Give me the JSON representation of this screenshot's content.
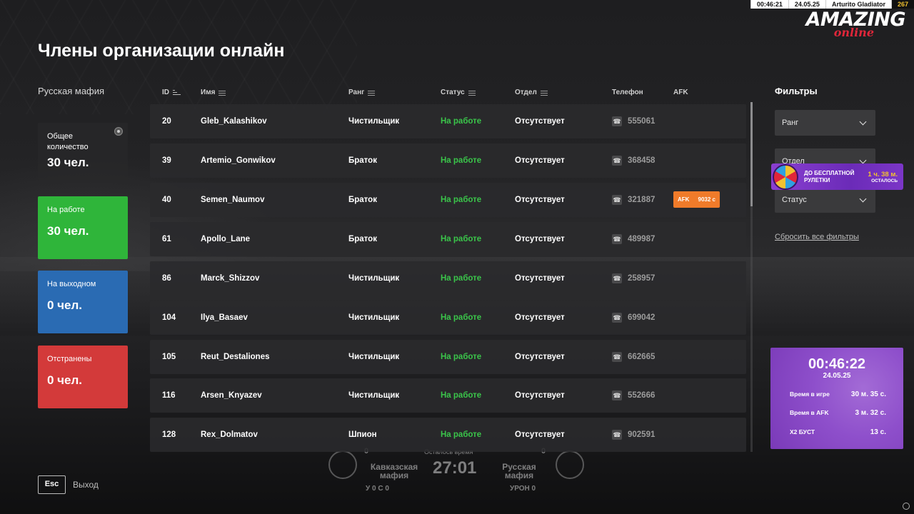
{
  "hud": {
    "time": "00:46:21",
    "date": "24.05.25",
    "player": "Arturito Gladiator",
    "level": "267"
  },
  "logo": {
    "main": "AMAZING",
    "sub": "online"
  },
  "page_title": "Члены организации онлайн",
  "org_name": "Русская мафия",
  "stats": {
    "total": {
      "label": "Общее количество",
      "value": "30 чел."
    },
    "working": {
      "label": "На работе",
      "value": "30 чел.",
      "color": "#2fb53a"
    },
    "off": {
      "label": "На выходном",
      "value": "0 чел.",
      "color": "#2a6bb3"
    },
    "suspended": {
      "label": "Отстранены",
      "value": "0 чел.",
      "color": "#d33a3a"
    }
  },
  "table": {
    "columns": {
      "id": "ID",
      "name": "Имя",
      "rank": "Ранг",
      "status": "Статус",
      "dept": "Отдел",
      "phone": "Телефон",
      "afk": "AFK"
    },
    "rows": [
      {
        "id": "20",
        "name": "Gleb_Kalashikov",
        "rank": "Чистильщик",
        "status": "На работе",
        "dept": "Отсутствует",
        "phone": "555061"
      },
      {
        "id": "39",
        "name": "Artemio_Gonwikov",
        "rank": "Браток",
        "status": "На работе",
        "dept": "Отсутствует",
        "phone": "368458"
      },
      {
        "id": "40",
        "name": "Semen_Naumov",
        "rank": "Браток",
        "status": "На работе",
        "dept": "Отсутствует",
        "phone": "321887",
        "afk_label": "AFK",
        "afk_value": "9032 с"
      },
      {
        "id": "61",
        "name": "Apollo_Lane",
        "rank": "Браток",
        "status": "На работе",
        "dept": "Отсутствует",
        "phone": "489987"
      },
      {
        "id": "86",
        "name": "Marck_Shizzov",
        "rank": "Чистильщик",
        "status": "На работе",
        "dept": "Отсутствует",
        "phone": "258957"
      },
      {
        "id": "104",
        "name": "Ilya_Basaev",
        "rank": "Чистильщик",
        "status": "На работе",
        "dept": "Отсутствует",
        "phone": "699042"
      },
      {
        "id": "105",
        "name": "Reut_Destaliones",
        "rank": "Чистильщик",
        "status": "На работе",
        "dept": "Отсутствует",
        "phone": "662665"
      },
      {
        "id": "116",
        "name": "Arsen_Knyazev",
        "rank": "Чистильщик",
        "status": "На работе",
        "dept": "Отсутствует",
        "phone": "552666"
      },
      {
        "id": "128",
        "name": "Rex_Dolmatov",
        "rank": "Шпион",
        "status": "На работе",
        "dept": "Отсутствует",
        "phone": "902591"
      }
    ]
  },
  "filters": {
    "title": "Фильтры",
    "rank": "Ранг",
    "dept": "Отдел",
    "status": "Статус",
    "reset": "Сбросить все фильтры"
  },
  "promo": {
    "text": "ДО БЕСПЛАТНОЙ РУЛЕТКИ",
    "time": "1 ч. 38 м.",
    "suffix": "ОСТАЛОСЬ"
  },
  "timebox": {
    "clock": "00:46:22",
    "date": "24.05.25",
    "game_label": "Время в игре",
    "game_value": "30 м. 35 с.",
    "afk_label": "Время в AFK",
    "afk_value": "3 м. 32 с.",
    "boost_label": "X2 БУСТ",
    "boost_value": "13 с."
  },
  "exit": {
    "key": "Esc",
    "label": "Выход"
  },
  "war": {
    "team_left": "Кавказская мафия",
    "team_right": "Русская мафия",
    "remaining_label": "Осталось время",
    "timer": "27:01",
    "score_left": "0",
    "score_right": "0",
    "left_stats": "У 0   С 0",
    "right_stats": "УРОН 0"
  },
  "colors": {
    "status_active": "#3ac54a",
    "afk_badge": "#f07b2a",
    "accent_red": "#e0263a"
  }
}
